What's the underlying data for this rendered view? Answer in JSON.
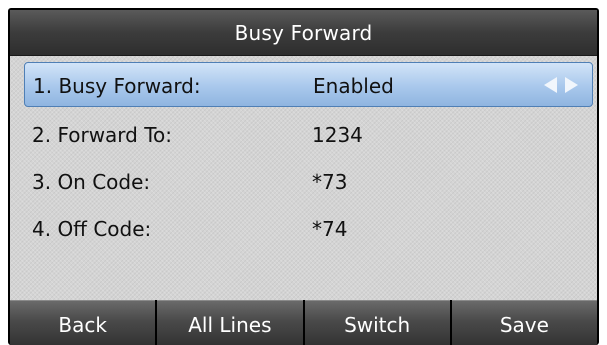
{
  "title": "Busy Forward",
  "rows": [
    {
      "label": "1. Busy Forward:",
      "value": "Enabled",
      "selected": true
    },
    {
      "label": "2. Forward To:",
      "value": "1234",
      "selected": false
    },
    {
      "label": "3. On Code:",
      "value": "*73",
      "selected": false
    },
    {
      "label": "4. Off Code:",
      "value": "*74",
      "selected": false
    }
  ],
  "softkeys": [
    "Back",
    "All Lines",
    "Switch",
    "Save"
  ],
  "colors": {
    "selected_row": "#a9c8ec",
    "content_bg": "#d4d4d4",
    "softkey_bg": "#4a4a4a",
    "title_bg": "#3c3c3c"
  },
  "icons": [
    "arrow-left-icon",
    "arrow-right-icon"
  ]
}
